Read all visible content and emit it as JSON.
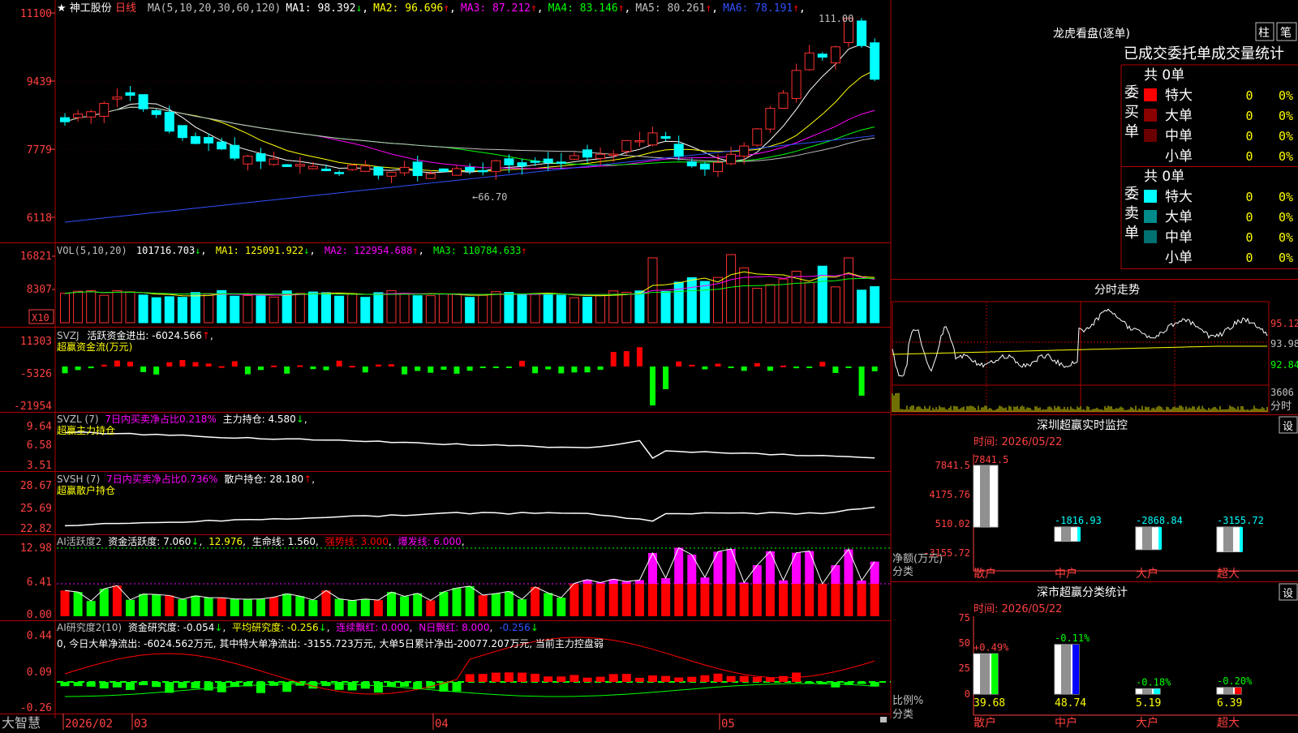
{
  "title_bar": {
    "star": "★",
    "stock_name": "神工股份",
    "period": "日线",
    "ma_params": "MA(5,10,20,30,60,120)"
  },
  "main_ma": [
    {
      "label": "MA1: 98.392",
      "arrow": "↓",
      "color": "#ffffff"
    },
    {
      "label": "MA2: 96.696",
      "arrow": "↑",
      "color": "#ffff00"
    },
    {
      "label": "MA3: 87.212",
      "arrow": "↑",
      "color": "#ff00ff"
    },
    {
      "label": "MA4: 83.146",
      "arrow": "↑",
      "color": "#00ff00"
    },
    {
      "label": "MA5: 80.261",
      "arrow": "↑",
      "color": "#c0c0c0"
    },
    {
      "label": "MA6: 78.191",
      "arrow": "↑",
      "color": "#3050ff"
    }
  ],
  "main_axis": [
    "11100",
    "9439",
    "7779",
    "6118"
  ],
  "max_annotation": "111.00",
  "min_annotation": "66.70",
  "vol_header": {
    "name": "VOL(5,10,20)",
    "value": "101716.703",
    "v_arrow": "↓",
    "ma1": "MA1: 125091.922",
    "ma1_arrow": "↓",
    "ma2": "MA2: 122954.688",
    "ma2_arrow": "↑",
    "ma3": "MA3: 110784.633",
    "ma3_arrow": "↑"
  },
  "vol_axis": [
    "16821",
    "8307"
  ],
  "vol_unit": "X10",
  "svzj": {
    "name": "SVZJ",
    "text": "活跃资金进出: -6024.566",
    "arrow": "↑",
    "comma": ",",
    "subtitle": "超赢资金流(万元)",
    "axis": [
      "11303",
      "-5326",
      "-21954"
    ]
  },
  "svzl": {
    "name": "SVZL (7)",
    "text1": "7日内买卖净占比0.218%",
    "text2": "主力持仓: 4.580",
    "arrow": "↓",
    "comma": ",",
    "subtitle": "超赢主力持仓",
    "axis": [
      "9.64",
      "6.58",
      "3.51"
    ]
  },
  "svsh": {
    "name": "SVSH (7)",
    "text1": "7日内买卖净占比0.736%",
    "text2": "散户持仓: 28.180",
    "arrow": "↑",
    "comma": ",",
    "subtitle": "超赢散户持仓",
    "axis": [
      "28.67",
      "25.69",
      "22.82"
    ]
  },
  "ai1": {
    "name": "AI活跃度2",
    "t1": "资金活跃度: 7.060",
    "a1": "↓",
    "t2": "12.976",
    "t3": "生命线: 1.560",
    "t4": "强势线: 3.000",
    "t5": "爆发线: 6.000",
    "axis": [
      "12.98",
      "6.41",
      "0.00"
    ]
  },
  "ai2": {
    "name": "AI研究度2(10)",
    "t1": "资金研究度: -0.054",
    "a1": "↓",
    "t2": "平均研究度: -0.256",
    "a2": "↓",
    "t3": "连续飘红: 0.000",
    "t4": "N日飘红: 8.000",
    "t5": "-0.256",
    "a5": "↓",
    "desc": "0, 今日大单净流出: -6024.562万元, 其中特大单净流出: -3155.723万元, 大单5日累计净出-20077.207万元, 当前主力控盘弱",
    "axis": [
      "0.44",
      "0.09",
      "-0.26"
    ]
  },
  "bottom_bar": {
    "logo": "大智慧",
    "dates": [
      "2026/02",
      "03",
      "04",
      "05"
    ]
  },
  "lhb": {
    "title": "龙虎看盘(逐单)",
    "btn_zhu": "柱",
    "btn_bi": "笔",
    "tab_title": "已成交委托单成交量统计",
    "buy_label": "委买单",
    "sell_label": "委卖单",
    "buy_total": "共 0单",
    "sell_total": "共 0单",
    "buy_rows": [
      {
        "name": "特大",
        "v": "0",
        "p": "0%",
        "color": "#ff0000"
      },
      {
        "name": "大单",
        "v": "0",
        "p": "0%",
        "color": "#8b0000"
      },
      {
        "name": "中单",
        "v": "0",
        "p": "0%",
        "color": "#6b0000"
      },
      {
        "name": "小单",
        "v": "0",
        "p": "0%",
        "color": ""
      }
    ],
    "sell_rows": [
      {
        "name": "特大",
        "v": "0",
        "p": "0%",
        "color": "#00ffff"
      },
      {
        "name": "大单",
        "v": "0",
        "p": "0%",
        "color": "#008b8b"
      },
      {
        "name": "中单",
        "v": "0",
        "p": "0%",
        "color": "#007070"
      },
      {
        "name": "小单",
        "v": "0",
        "p": "0%",
        "color": ""
      }
    ]
  },
  "fenshi": {
    "title": "分时走势",
    "axis": [
      "95.12",
      "93.98",
      "92.84",
      "3606"
    ],
    "unit": "分时"
  },
  "monitor": {
    "title": "深圳超赢实时监控",
    "set": "设",
    "time": "时间: 2026/05/22",
    "axis": [
      "7841.5",
      "4175.76",
      "510.02",
      "-3155.72"
    ],
    "ylabel": "净额(万元)",
    "ylabel2": "分类",
    "bars": [
      {
        "cat": "散户",
        "value": "7841.5"
      },
      {
        "cat": "中户",
        "value": "-1816.93"
      },
      {
        "cat": "大户",
        "value": "-2868.84"
      },
      {
        "cat": "超大",
        "value": "-3155.72"
      }
    ]
  },
  "classify": {
    "title": "深市超赢分类统计",
    "set": "设",
    "time": "时间: 2026/05/22",
    "axis": [
      "75",
      "50",
      "25",
      "0"
    ],
    "ylabel": "比例%",
    "ylabel2": "分类",
    "bars": [
      {
        "cat": "散户",
        "top": "+0.49%",
        "bottom": "39.68",
        "color": "#00ff00"
      },
      {
        "cat": "中户",
        "top": "-0.11%",
        "bottom": "48.74",
        "color": "#0000ff"
      },
      {
        "cat": "大户",
        "top": "-0.18%",
        "bottom": "5.19",
        "color": "#00ffff"
      },
      {
        "cat": "超大",
        "top": "-0.20%",
        "bottom": "6.39",
        "color": "#ff0000"
      }
    ]
  }
}
